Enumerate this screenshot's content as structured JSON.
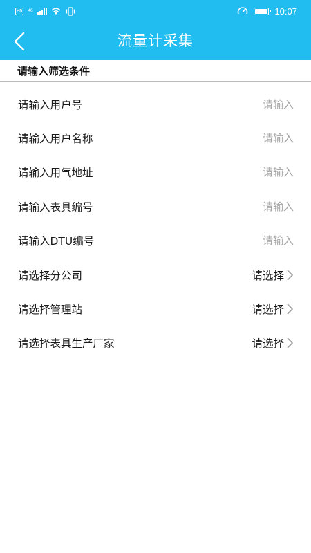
{
  "status_bar": {
    "hd_badge": "HD",
    "network": "4G",
    "time": "10:07",
    "icons": [
      "hd-icon",
      "signal-icon",
      "wifi-hotspot-icon",
      "vibrate-icon",
      "speedometer-icon",
      "battery-icon"
    ]
  },
  "header": {
    "title": "流量计采集",
    "back_icon": "chevron-left-icon",
    "background_color": "#22bdf0"
  },
  "filter": {
    "section_title": "请输入筛选条件",
    "text_fields": [
      {
        "label": "请输入用户号",
        "placeholder": "请输入",
        "value": ""
      },
      {
        "label": "请输入用户名称",
        "placeholder": "请输入",
        "value": ""
      },
      {
        "label": "请输入用气地址",
        "placeholder": "请输入",
        "value": ""
      },
      {
        "label": "请输入表具编号",
        "placeholder": "请输入",
        "value": ""
      },
      {
        "label": "请输入DTU编号",
        "placeholder": "请输入",
        "value": ""
      }
    ],
    "select_fields": [
      {
        "label": "请选择分公司",
        "selected": "请选择"
      },
      {
        "label": "请选择管理站",
        "selected": "请选择"
      },
      {
        "label": "请选择表具生产厂家",
        "selected": "请选择"
      }
    ]
  }
}
